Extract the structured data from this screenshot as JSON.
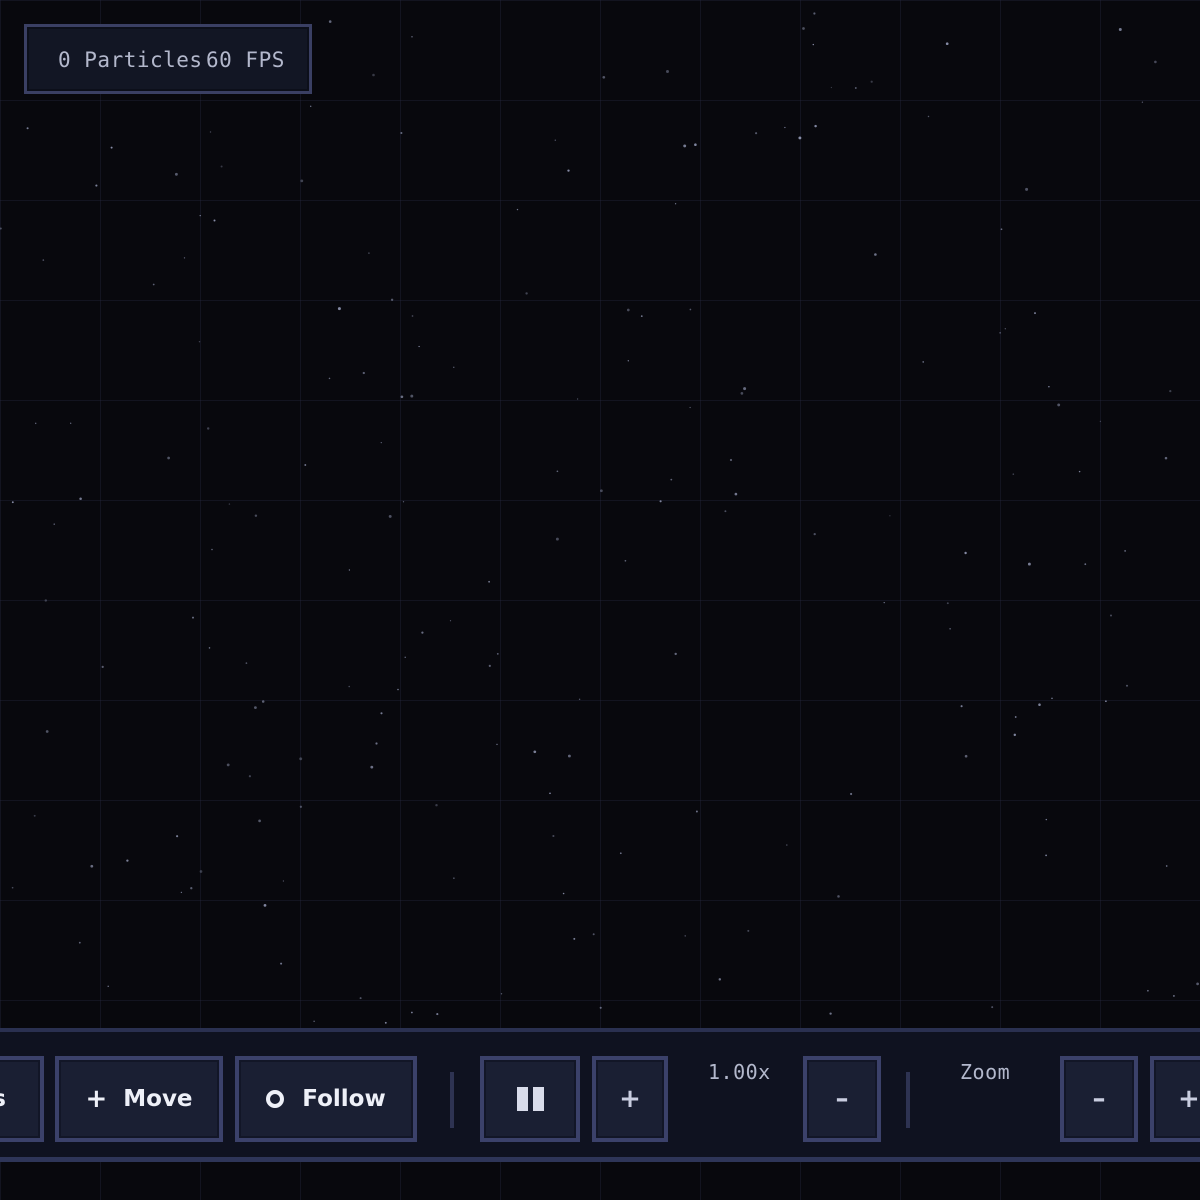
{
  "hud": {
    "particles": "0 Particles",
    "fps": "60 FPS"
  },
  "toolbar": {
    "partial_left_label": "s",
    "move_label": "Move",
    "move_icon": "+",
    "follow_label": "Follow",
    "pause_icon": "pause-icon",
    "speed_up_label": "+",
    "speed_value": "1.00x",
    "speed_down_label": "–",
    "zoom_label": "Zoom",
    "zoom_out_label": "–",
    "zoom_in_label": "+"
  },
  "colors": {
    "background": "#08080d",
    "grid": "#1c2033",
    "panel": "#121624",
    "panel_border": "#3a3f63",
    "button": "#1a1f33",
    "button_border": "#3b416a",
    "text_primary": "#eef0f8",
    "text_muted": "#b3b8cc"
  }
}
